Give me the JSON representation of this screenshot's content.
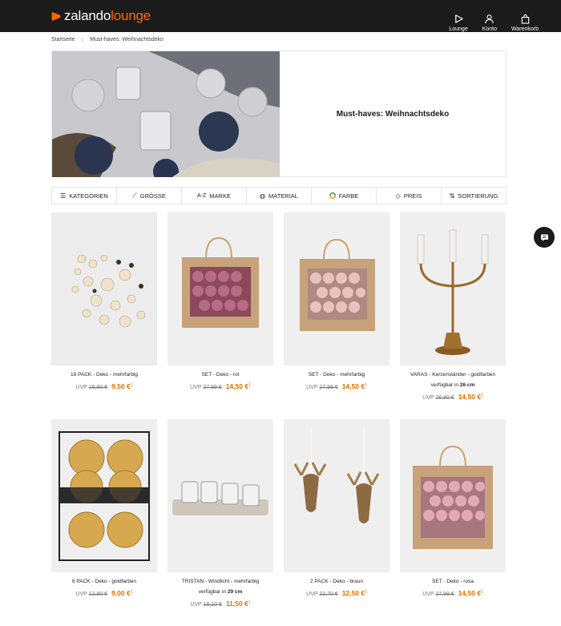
{
  "brand": {
    "name_part1": "zalando",
    "name_part2": "lounge",
    "accent": "#ff6900",
    "price_color": "#e07000"
  },
  "nav": [
    {
      "label": "Lounge",
      "icon": "lounge-icon"
    },
    {
      "label": "Konto",
      "icon": "user-icon"
    },
    {
      "label": "Warenkorb",
      "icon": "bag-icon"
    }
  ],
  "breadcrumb": {
    "home": "Startseite",
    "current": "Must-haves: Weihnachtsdeko"
  },
  "hero": {
    "title": "Must-haves: Weihnachtsdeko"
  },
  "filters": [
    {
      "label": "KATEGORIEN",
      "icon": "menu-icon"
    },
    {
      "label": "GRÖSSE",
      "icon": "ruler-icon"
    },
    {
      "label": "MARKE",
      "icon": "az-icon"
    },
    {
      "label": "MATERIAL",
      "icon": "material-icon"
    },
    {
      "label": "FARBE",
      "icon": "color-icon"
    },
    {
      "label": "PREIS",
      "icon": "tag-icon"
    },
    {
      "label": "SORTIERUNG",
      "icon": "sort-icon"
    }
  ],
  "products": [
    {
      "name": "18 PACK - Deko - mehrfarbig",
      "uvp": "UVP",
      "old": "16,80 €",
      "new": "9,50 €",
      "sup": "1",
      "avail_prefix": "",
      "avail_value": ""
    },
    {
      "name": "SET - Deko - rot",
      "uvp": "UVP",
      "old": "27,99 €",
      "new": "14,50 €",
      "sup": "1",
      "avail_prefix": "",
      "avail_value": ""
    },
    {
      "name": "SET - Deko - mehrfarbig",
      "uvp": "UVP",
      "old": "27,99 €",
      "new": "14,50 €",
      "sup": "1",
      "avail_prefix": "",
      "avail_value": ""
    },
    {
      "name": "VARAS - Kerzenständer - goldfarben",
      "uvp": "UVP",
      "old": "26,80 €",
      "new": "14,50 €",
      "sup": "1",
      "avail_prefix": "verfügbar in",
      "avail_value": "26 cm"
    },
    {
      "name": "6 PACK - Deko - goldfarben",
      "uvp": "UVP",
      "old": "12,80 €",
      "new": "9,00 €",
      "sup": "1",
      "avail_prefix": "",
      "avail_value": ""
    },
    {
      "name": "TRISTAN - Windlicht - mehrfarbig",
      "uvp": "UVP",
      "old": "18,10 €",
      "new": "11,50 €",
      "sup": "1",
      "avail_prefix": "verfügbar in",
      "avail_value": "29 cm"
    },
    {
      "name": "2 PACK - Deko - braun",
      "uvp": "UVP",
      "old": "22,70 €",
      "new": "12,50 €",
      "sup": "1",
      "avail_prefix": "",
      "avail_value": ""
    },
    {
      "name": "SET - Deko - rosa",
      "uvp": "UVP",
      "old": "27,99 €",
      "new": "14,50 €",
      "sup": "1",
      "avail_prefix": "",
      "avail_value": ""
    }
  ]
}
